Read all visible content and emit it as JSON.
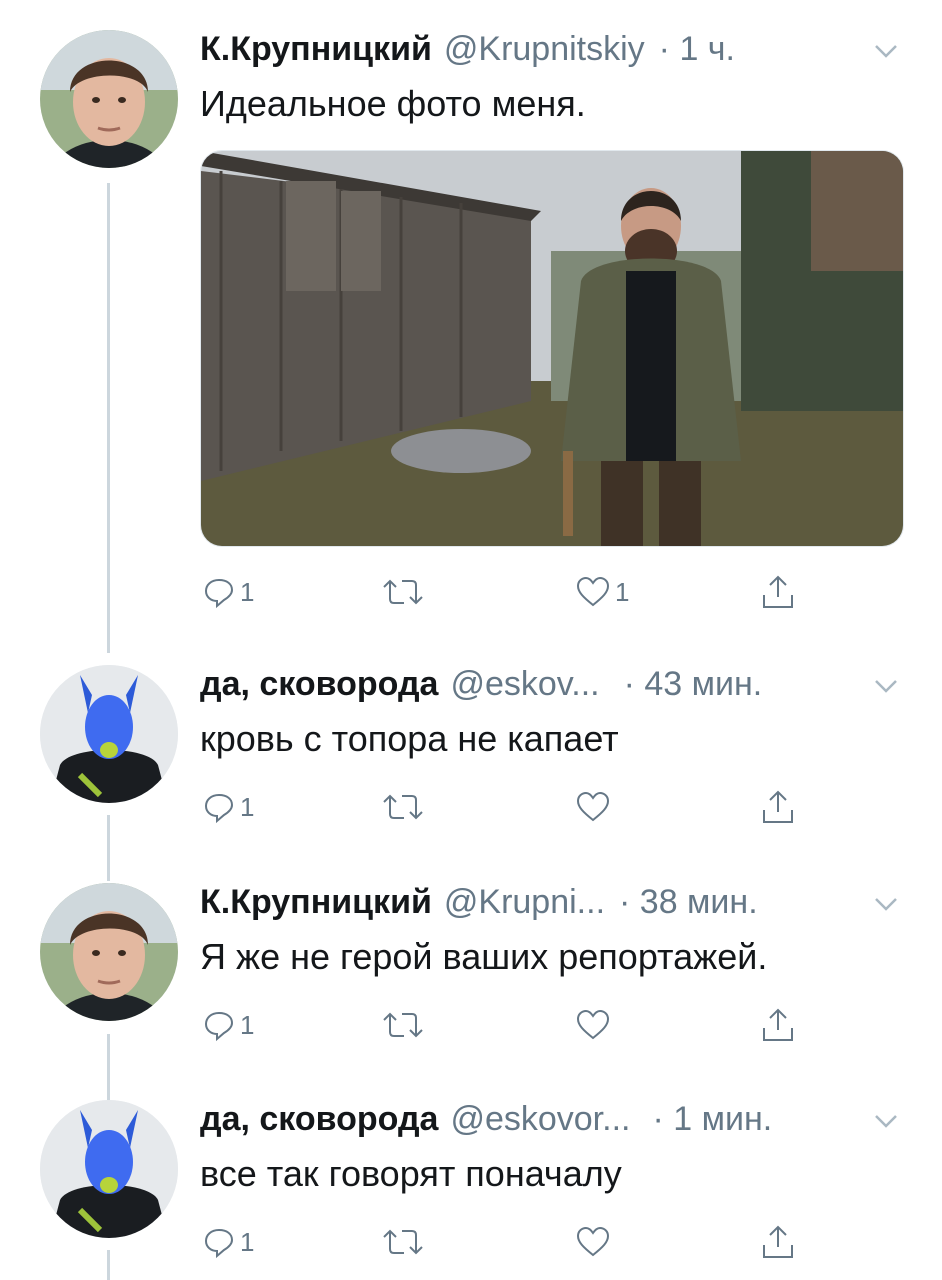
{
  "tweets": [
    {
      "name": "К.Крупницкий",
      "handle": "@Krupnitskiy",
      "time": "· 1 ч.",
      "text": "Идеальное фото меня.",
      "has_photo": true,
      "reply_count": "1",
      "like_count": "1"
    },
    {
      "name": "да, сковорода",
      "handle": "@eskov...",
      "time": "· 43 мин.",
      "text": "кровь с топора не капает",
      "reply_count": "1",
      "like_count": ""
    },
    {
      "name": "К.Крупницкий",
      "handle": "@Krupni...",
      "time": "· 38 мин.",
      "text": "Я же не герой ваших репортажей.",
      "reply_count": "1",
      "like_count": ""
    },
    {
      "name": "да, сковорода",
      "handle": "@eskovor...",
      "time": "· 1 мин.",
      "text": "все так говорят поначалу",
      "reply_count": "1",
      "like_count": ""
    }
  ],
  "icons": {
    "reply": "reply-icon",
    "retweet": "retweet-icon",
    "like": "heart-icon",
    "share": "share-icon",
    "caret": "chevron-down-icon"
  },
  "colors": {
    "text": "#14171a",
    "secondary": "#657786",
    "thread_line": "#ccd6dd"
  }
}
